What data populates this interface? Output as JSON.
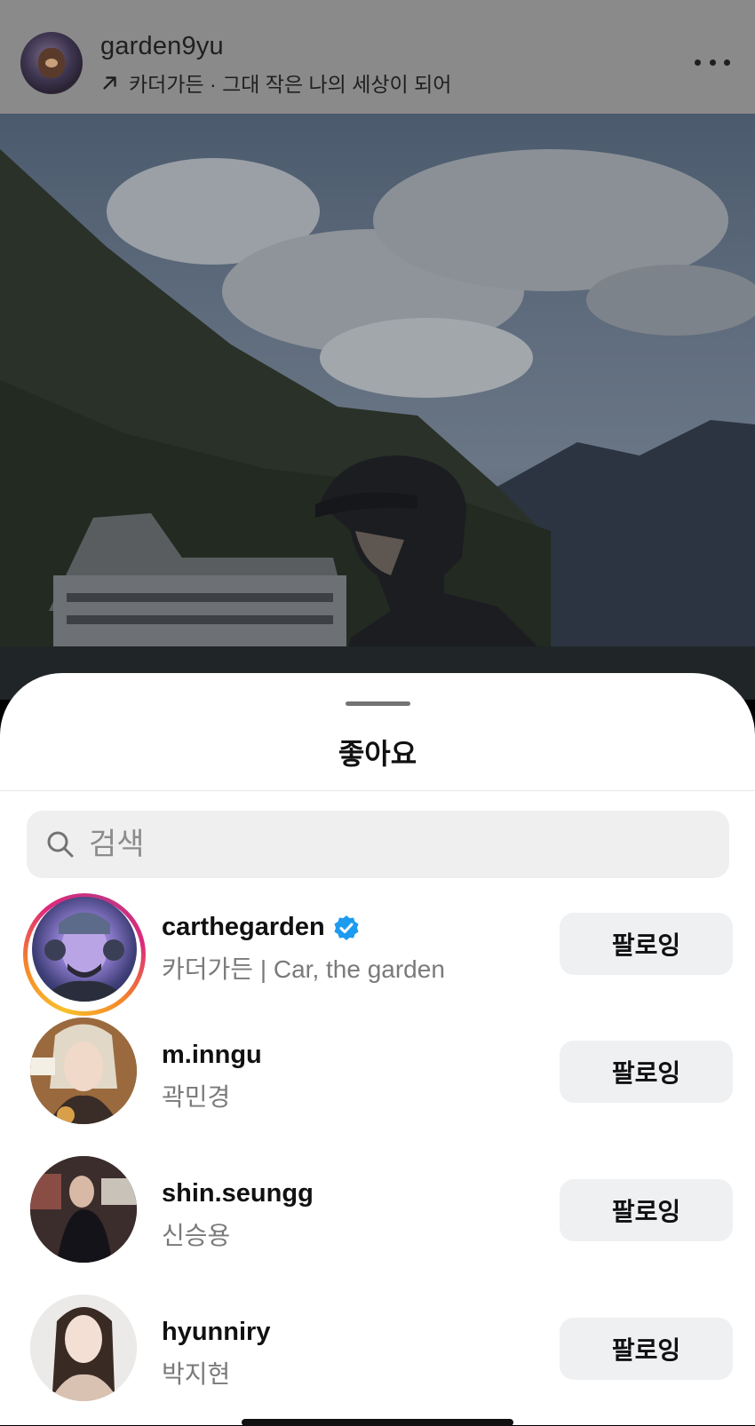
{
  "post": {
    "username": "garden9yu",
    "subtitle": "카더가든 · 그대 작은 나의 세상이 되어"
  },
  "sheet": {
    "title": "좋아요",
    "search_placeholder": "검색"
  },
  "likers": [
    {
      "username": "carthegarden",
      "fullname": "카더가든 | Car, the garden",
      "verified": true,
      "button": "팔로잉"
    },
    {
      "username": "m.inngu",
      "fullname": "곽민경",
      "verified": false,
      "button": "팔로잉"
    },
    {
      "username": "shin.seungg",
      "fullname": "신승용",
      "verified": false,
      "button": "팔로잉"
    },
    {
      "username": "hyunniry",
      "fullname": "박지현",
      "verified": false,
      "button": "팔로잉"
    }
  ],
  "colors": {
    "verified": "#1d9bf0",
    "button_bg": "#eef0f2"
  }
}
